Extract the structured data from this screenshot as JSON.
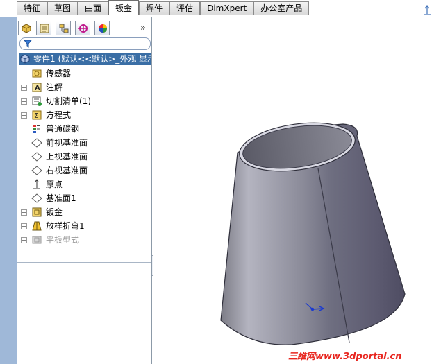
{
  "tabs": [
    {
      "label": "特征",
      "active": false
    },
    {
      "label": "草图",
      "active": false
    },
    {
      "label": "曲面",
      "active": false
    },
    {
      "label": "钣金",
      "active": true
    },
    {
      "label": "焊件",
      "active": false
    },
    {
      "label": "评估",
      "active": false
    },
    {
      "label": "DimXpert",
      "active": false
    },
    {
      "label": "办公室产品",
      "active": false
    }
  ],
  "manager_tabs": [
    {
      "icon": "featuremanager-icon",
      "active": true
    },
    {
      "icon": "propertymanager-icon",
      "active": false
    },
    {
      "icon": "configurationmanager-icon",
      "active": false
    },
    {
      "icon": "dimxpertmanager-icon",
      "active": false
    },
    {
      "icon": "displaymanager-icon",
      "active": false
    }
  ],
  "manager_expand_label": "»",
  "tree": {
    "root_label": "零件1  (默认<<默认>_外观 显示",
    "items": [
      {
        "label": "传感器",
        "icon": "sensor-icon",
        "expandable": false,
        "greyed": false
      },
      {
        "label": "注解",
        "icon": "annotation-icon",
        "expandable": true,
        "greyed": false
      },
      {
        "label": "切割清单(1)",
        "icon": "cutlist-icon",
        "expandable": true,
        "greyed": false
      },
      {
        "label": "方程式",
        "icon": "equation-icon",
        "expandable": true,
        "greyed": false
      },
      {
        "label": "普通碳钢",
        "icon": "material-icon",
        "expandable": false,
        "greyed": false
      },
      {
        "label": "前视基准面",
        "icon": "plane-icon",
        "expandable": false,
        "greyed": false
      },
      {
        "label": "上视基准面",
        "icon": "plane-icon",
        "expandable": false,
        "greyed": false
      },
      {
        "label": "右视基准面",
        "icon": "plane-icon",
        "expandable": false,
        "greyed": false
      },
      {
        "label": "原点",
        "icon": "origin-icon",
        "expandable": false,
        "greyed": false
      },
      {
        "label": "基准面1",
        "icon": "plane-icon",
        "expandable": false,
        "greyed": false
      },
      {
        "label": "钣金",
        "icon": "sheetmetal-icon",
        "expandable": true,
        "greyed": false
      },
      {
        "label": "放样折弯1",
        "icon": "lofted-bend-icon",
        "expandable": true,
        "greyed": false
      },
      {
        "label": "平板型式",
        "icon": "flat-pattern-icon",
        "expandable": true,
        "greyed": true
      }
    ]
  },
  "watermark": "三维网www.3dportal.cn",
  "colors": {
    "selection": "#3a6ea5",
    "left_strip": "#9fb8d8",
    "part_body": "#8a8aa0",
    "watermark": "#e8261f"
  }
}
